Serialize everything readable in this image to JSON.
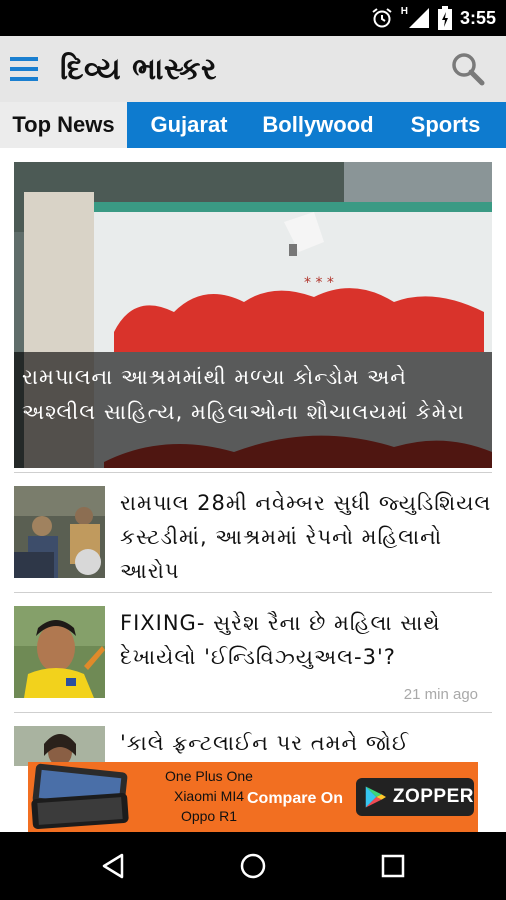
{
  "status_bar": {
    "time": "3:55",
    "network_label": "H",
    "icons": [
      "alarm-icon",
      "signal-icon",
      "battery-icon"
    ]
  },
  "app_bar": {
    "logo_text": "દિવ્ય ભાસ્કર",
    "menu_icon": "hamburger-menu-icon",
    "search_icon": "search-icon"
  },
  "tabs": [
    {
      "label": "Top News",
      "active": true
    },
    {
      "label": "Gujarat",
      "active": false
    },
    {
      "label": "Bollywood",
      "active": false
    },
    {
      "label": "Sports",
      "active": false
    }
  ],
  "hero": {
    "caption": "રામપાલના આશ્રમમાંથી મળ્યા કોન્ડોમ અને અશ્લીલ સાહિત્ય, મહિલાઓના શૌચાલયમાં કેમેરા"
  },
  "articles": [
    {
      "title": "રામપાલ 28મી નવેમ્બર સુધી જ્યુડિશિયલ કસ્ટડીમાં, આશ્રમમાં રેપનો મહિલાનો આરોપ",
      "time": ""
    },
    {
      "title": "FIXING- સુરેશ રૈના છે મહિલા સાથે દેખાયેલો 'ઈન્ડિવિઝ્યુઅલ-3'?",
      "time": "21 min ago"
    },
    {
      "title": "'કાલે ફ્રન્ટલાઈન પર તમને જોઈ",
      "time": ""
    }
  ],
  "ad": {
    "models": [
      "One Plus One",
      "Xiaomi MI4",
      "Oppo R1"
    ],
    "compare_text": "Compare On",
    "brand": "ZOPPER",
    "colors": {
      "background": "#f26f21",
      "badge": "#222222"
    }
  },
  "nav_bar": {
    "icons": [
      "back-icon",
      "home-icon",
      "recents-icon"
    ]
  },
  "colors": {
    "tab_bar": "#0e7bcf",
    "app_bar": "#e6e6e6",
    "menu_icon": "#1a7fd0"
  }
}
